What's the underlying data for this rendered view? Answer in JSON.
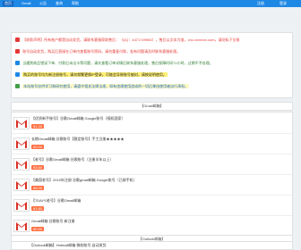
{
  "nav": {
    "items": [
      "首页",
      "Gmail",
      "公告",
      "查询",
      "帮助"
    ],
    "right": [
      "注册",
      "登录"
    ]
  },
  "notice": {
    "lines": [
      {
        "text": "【收款声明】所有账户都是自动发货，请联系客服获取售后：（QQ：4471749983），售后以文本为准，cnc.xxxxxxx.com，请勿私下交易",
        "color": "#e53935",
        "icon": "#e53935"
      },
      {
        "text": "账号自动发货，购买后直接在订单内查看账号密码，请勿重复付款，若有问题请及时联系客服处理。",
        "color": "#e53935",
        "icon": "#e53935"
      },
      {
        "text": "当遇到商品错误下单、付款后未出卡等问题，请先查看订单详情后联系客服处理，售后保障时间72小时，过期不予处理。",
        "color": "#2e7d32",
        "icon": "#1e88e5"
      },
      {
        "text": "购买的账号均为新注册账号，请勿频繁更换IP登录，可能会导致账号被封，请按说明使用。",
        "color": "#222",
        "icon": "#1e88e5",
        "highlight": "#fff176"
      },
      {
        "text": "本站账号仅供学习和研究使用，请遵守相关法律法规，如有违规使用造成的一切后果由使用者自行承担。",
        "color": "#1565c0",
        "icon": "#43a047",
        "highlight": "#fff9c4"
      }
    ]
  },
  "section1": {
    "title": "【Gmail邮箱】"
  },
  "products": [
    {
      "title": "【优质新手账号】谷歌Gmail邮箱 Google账号（随机国家）",
      "price": "¥1.20"
    },
    {
      "title": "长期Gmail邮箱 谷歌账号【稳定账号】手工注册★★★★★",
      "price": "¥2.00"
    },
    {
      "title": "【老号】谷歌Gmail邮箱 谷歌账号（注册半年以上）",
      "price": "¥3.60"
    },
    {
      "title": "【美国老号】2019年注册 谷歌gmail邮箱 Google账号（已绑手机）",
      "price": "¥8.00"
    },
    {
      "title": "【7DAYS老号】谷歌Gmail邮箱",
      "price": "¥1.80"
    },
    {
      "title": "Gmail邮箱 谷歌账号 新注册",
      "price": "¥0.90"
    }
  ],
  "section2": {
    "title": "【Outlook邮箱】"
  },
  "footer": {
    "text": "【Outlook邮箱】Hotmail邮箱 微软账号 自动发货"
  }
}
